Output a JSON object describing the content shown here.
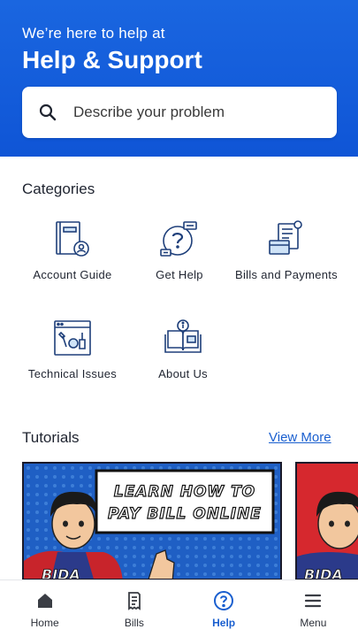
{
  "header": {
    "subtitle": "We’re here to help at",
    "title": "Help & Support"
  },
  "search": {
    "placeholder": "Describe your problem",
    "icon": "search-icon"
  },
  "categories": {
    "title": "Categories",
    "items": [
      {
        "label": "Account Guide",
        "icon": "account-guide-icon"
      },
      {
        "label": "Get Help",
        "icon": "get-help-icon"
      },
      {
        "label": "Bills and Payments",
        "icon": "bills-payments-icon"
      },
      {
        "label": "Technical Issues",
        "icon": "technical-issues-icon"
      },
      {
        "label": "About Us",
        "icon": "about-us-icon"
      }
    ]
  },
  "tutorials": {
    "title": "Tutorials",
    "view_more": "View More",
    "cards": [
      {
        "banner_line1": "LEARN HOW TO",
        "banner_line2": "PAY BILL ONLINE",
        "badge": "BIDA"
      },
      {
        "badge": "BIDA"
      }
    ]
  },
  "bottom_nav": {
    "items": [
      {
        "label": "Home",
        "icon": "home-icon"
      },
      {
        "label": "Bills",
        "icon": "bills-icon"
      },
      {
        "label": "Help",
        "icon": "help-icon",
        "active": true
      },
      {
        "label": "Menu",
        "icon": "menu-icon"
      }
    ]
  },
  "colors": {
    "brand_blue": "#1463df",
    "link_blue": "#1a5fcf",
    "icon_navy": "#1e3f7a"
  }
}
